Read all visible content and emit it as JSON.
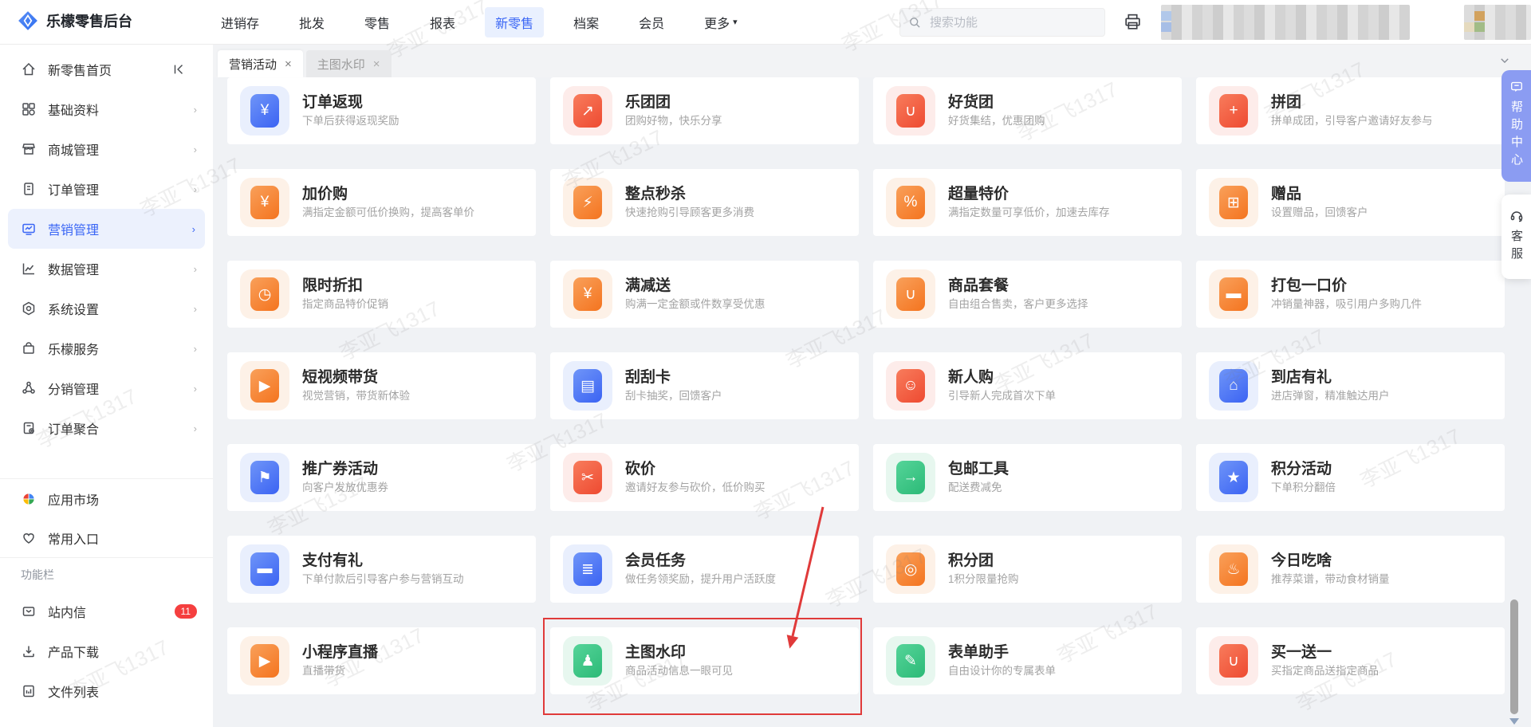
{
  "app": {
    "title": "乐檬零售后台"
  },
  "colors": {
    "accent_blue": "#3a66f5",
    "annotation_red": "#e03a3a",
    "help_tab_purple": "#8b9cf2",
    "badge_red": "#f53f3f"
  },
  "topbar": {
    "nav": [
      {
        "label": "进销存",
        "active": false
      },
      {
        "label": "批发",
        "active": false
      },
      {
        "label": "零售",
        "active": false
      },
      {
        "label": "报表",
        "active": false
      },
      {
        "label": "新零售",
        "active": true
      },
      {
        "label": "档案",
        "active": false
      },
      {
        "label": "会员",
        "active": false
      },
      {
        "label": "更多",
        "active": false
      }
    ],
    "more_caret": "▾",
    "search_placeholder": "搜索功能"
  },
  "tabs": [
    {
      "label": "营销活动",
      "close": "×",
      "active": true
    },
    {
      "label": "主图水印",
      "close": "×",
      "active": false
    }
  ],
  "sidebar": {
    "items": [
      {
        "label": "新零售首页"
      },
      {
        "label": "基础资料"
      },
      {
        "label": "商城管理"
      },
      {
        "label": "订单管理"
      },
      {
        "label": "营销管理",
        "selected": true
      },
      {
        "label": "数据管理"
      },
      {
        "label": "系统设置"
      },
      {
        "label": "乐檬服务"
      },
      {
        "label": "分销管理"
      },
      {
        "label": "订单聚合"
      }
    ],
    "chevron": "›",
    "quick": [
      {
        "label": "应用市场"
      },
      {
        "label": "常用入口"
      }
    ],
    "section_label": "功能栏",
    "tools": [
      {
        "label": "站内信",
        "badge": "11"
      },
      {
        "label": "产品下载"
      },
      {
        "label": "文件列表"
      }
    ]
  },
  "cards": [
    {
      "title": "订单返现",
      "subtitle": "下单后获得返现奖励",
      "theme": "blue",
      "glyph": "¥"
    },
    {
      "title": "乐团团",
      "subtitle": "团购好物，快乐分享",
      "theme": "red",
      "glyph": "↗"
    },
    {
      "title": "好货团",
      "subtitle": "好货集结，优惠团购",
      "theme": "red",
      "glyph": "∪"
    },
    {
      "title": "拼团",
      "subtitle": "拼单成团，引导客户邀请好友参与",
      "theme": "red",
      "glyph": "+"
    },
    {
      "title": "加价购",
      "subtitle": "满指定金额可低价换购，提高客单价",
      "theme": "orange",
      "glyph": "¥"
    },
    {
      "title": "整点秒杀",
      "subtitle": "快速抢购引导顾客更多消费",
      "theme": "orange",
      "glyph": "⚡"
    },
    {
      "title": "超量特价",
      "subtitle": "满指定数量可享低价，加速去库存",
      "theme": "orange",
      "glyph": "%"
    },
    {
      "title": "赠品",
      "subtitle": "设置赠品，回馈客户",
      "theme": "orange",
      "glyph": "⊞"
    },
    {
      "title": "限时折扣",
      "subtitle": "指定商品特价促销",
      "theme": "orange",
      "glyph": "◷"
    },
    {
      "title": "满减送",
      "subtitle": "购满一定金额或件数享受优惠",
      "theme": "orange",
      "glyph": "¥"
    },
    {
      "title": "商品套餐",
      "subtitle": "自由组合售卖，客户更多选择",
      "theme": "orange",
      "glyph": "∪"
    },
    {
      "title": "打包一口价",
      "subtitle": "冲销量神器，吸引用户多购几件",
      "theme": "orange",
      "glyph": "▬"
    },
    {
      "title": "短视频带货",
      "subtitle": "视觉营销，带货新体验",
      "theme": "orange",
      "glyph": "▶"
    },
    {
      "title": "刮刮卡",
      "subtitle": "刮卡抽奖，回馈客户",
      "theme": "blue",
      "glyph": "▤"
    },
    {
      "title": "新人购",
      "subtitle": "引导新人完成首次下单",
      "theme": "red",
      "glyph": "☺"
    },
    {
      "title": "到店有礼",
      "subtitle": "进店弹窗，精准触达用户",
      "theme": "blue",
      "glyph": "⌂"
    },
    {
      "title": "推广券活动",
      "subtitle": "向客户发放优惠券",
      "theme": "blue",
      "glyph": "⚑"
    },
    {
      "title": "砍价",
      "subtitle": "邀请好友参与砍价，低价购买",
      "theme": "red",
      "glyph": "✂"
    },
    {
      "title": "包邮工具",
      "subtitle": "配送费减免",
      "theme": "green",
      "glyph": "→"
    },
    {
      "title": "积分活动",
      "subtitle": "下单积分翻倍",
      "theme": "blue",
      "glyph": "★"
    },
    {
      "title": "支付有礼",
      "subtitle": "下单付款后引导客户参与营销互动",
      "theme": "blue",
      "glyph": "▬"
    },
    {
      "title": "会员任务",
      "subtitle": "做任务领奖励，提升用户活跃度",
      "theme": "blue",
      "glyph": "≣"
    },
    {
      "title": "积分团",
      "subtitle": "1积分限量抢购",
      "theme": "orange",
      "glyph": "◎"
    },
    {
      "title": "今日吃啥",
      "subtitle": "推荐菜谱，带动食材销量",
      "theme": "orange",
      "glyph": "♨"
    },
    {
      "title": "小程序直播",
      "subtitle": "直播带货",
      "theme": "orange",
      "glyph": "▶"
    },
    {
      "title": "主图水印",
      "subtitle": "商品活动信息一眼可见",
      "theme": "green",
      "glyph": "♟",
      "highlighted": true
    },
    {
      "title": "表单助手",
      "subtitle": "自由设计你的专属表单",
      "theme": "green",
      "glyph": "✎"
    },
    {
      "title": "买一送一",
      "subtitle": "买指定商品送指定商品",
      "theme": "red",
      "glyph": "∪"
    }
  ],
  "right_rail": {
    "help_center": "帮助中心",
    "customer_service": "客服"
  },
  "watermark": {
    "text": "李亚飞1317"
  }
}
